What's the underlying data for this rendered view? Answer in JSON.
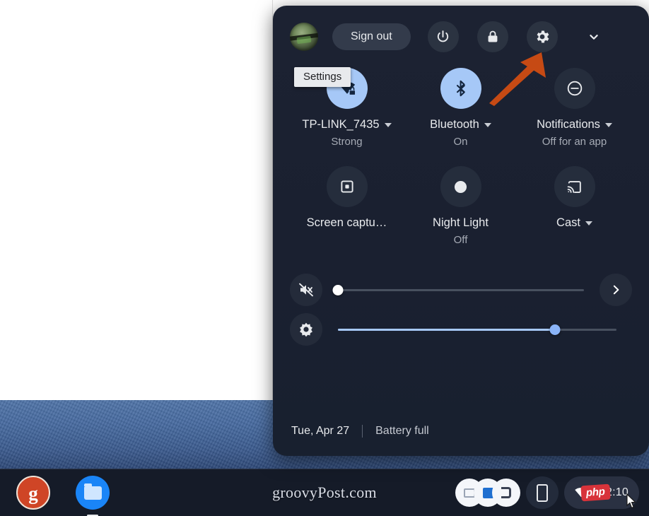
{
  "desktop": {
    "shelf": {
      "apps": [
        {
          "name": "groovypost",
          "glyph": "g"
        },
        {
          "name": "files",
          "glyph": ""
        }
      ],
      "watermark": "groovyPost.com",
      "tray": {
        "time": "2:10",
        "overlay_badge": "php",
        "network_icon": "wifi-icon",
        "battery_icon": "battery-icon"
      },
      "pwa_cluster_name": "pinned-web-apps",
      "phone_hub_name": "phone-hub-icon"
    }
  },
  "quick_settings": {
    "top_row": {
      "avatar_label": "user-avatar",
      "sign_out": "Sign out",
      "power_icon": "power-icon",
      "lock_icon": "lock-icon",
      "settings_icon": "gear-icon",
      "collapse_icon": "chevron-down-icon"
    },
    "tooltip": "Settings",
    "tiles": [
      {
        "id": "network",
        "icon": "wifi-locked-icon",
        "label": "TP-LINK_7435",
        "sublabel": "Strong",
        "has_caret": true,
        "active": true
      },
      {
        "id": "bluetooth",
        "icon": "bluetooth-icon",
        "label": "Bluetooth",
        "sublabel": "On",
        "has_caret": true,
        "active": true
      },
      {
        "id": "notifications",
        "icon": "do-not-disturb-icon",
        "label": "Notifications",
        "sublabel": "Off for an app",
        "has_caret": true,
        "active": false
      },
      {
        "id": "screen-capture",
        "icon": "screen-capture-icon",
        "label": "Screen captu…",
        "sublabel": "",
        "has_caret": false,
        "active": false
      },
      {
        "id": "night-light",
        "icon": "night-light-icon",
        "label": "Night Light",
        "sublabel": "Off",
        "has_caret": false,
        "active": false
      },
      {
        "id": "cast",
        "icon": "cast-icon",
        "label": "Cast",
        "sublabel": "",
        "has_caret": true,
        "active": false
      }
    ],
    "sliders": [
      {
        "id": "volume",
        "icon": "volume-muted-icon",
        "value": 0,
        "trailing_icon": "chevron-right-icon"
      },
      {
        "id": "brightness",
        "icon": "brightness-icon",
        "value": 78,
        "trailing_icon": ""
      }
    ],
    "footer": {
      "date": "Tue, Apr 27",
      "battery": "Battery full"
    }
  },
  "annotation": {
    "arrow_color": "#c64a14",
    "arrow_name": "orange-pointer-arrow"
  },
  "colors": {
    "panel_bg": "#1a2030",
    "accent_blue": "#a6c8f7",
    "shelf_bg": "#151b28",
    "wallpaper": "#466aa0",
    "badge_red": "#d8333a"
  }
}
